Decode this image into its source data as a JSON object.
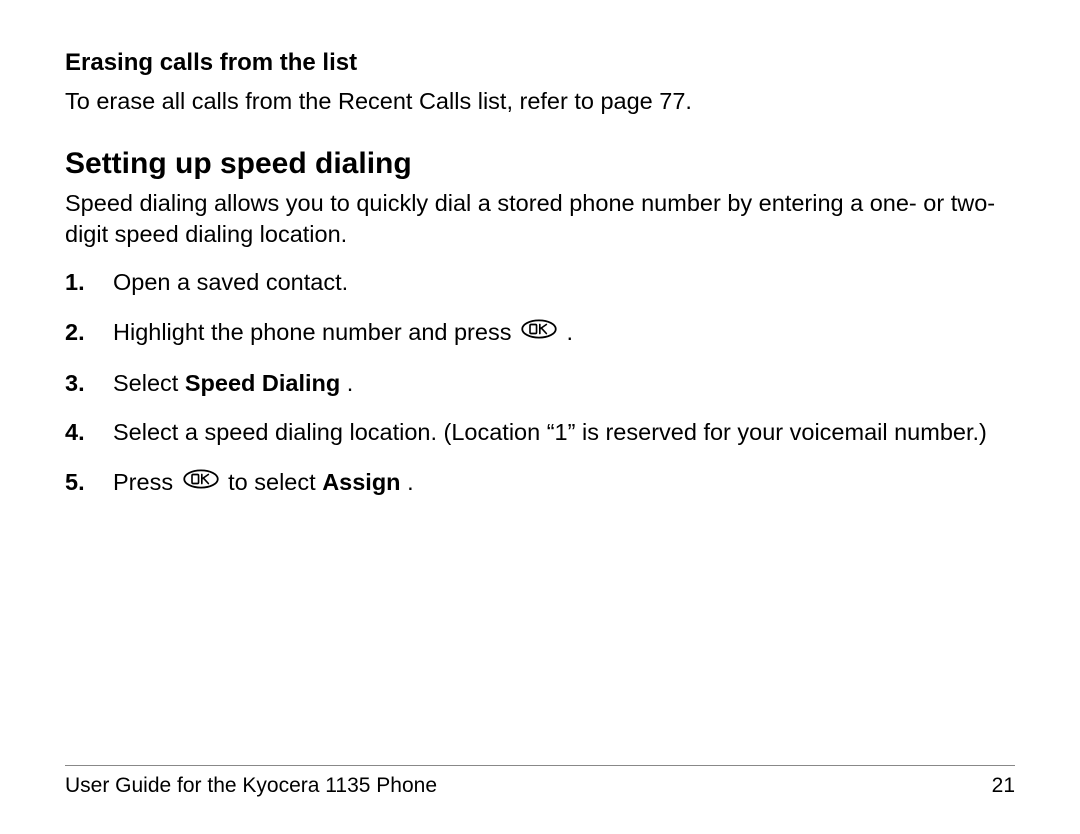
{
  "subsection_heading": "Erasing calls from the list",
  "subsection_body": "To erase all calls from the Recent Calls list, refer to page 77.",
  "section_heading": "Setting up speed dialing",
  "section_intro": "Speed dialing allows you to quickly dial a stored phone number by entering a one- or two-digit speed dialing location.",
  "steps": {
    "s1_num": "1.",
    "s1_text": "Open a saved contact.",
    "s2_num": "2.",
    "s2_text_before": "Highlight the phone number and press ",
    "s2_text_after": " .",
    "s3_num": "3.",
    "s3_text_before": "Select ",
    "s3_bold": "Speed Dialing",
    "s3_text_after": ".",
    "s4_num": "4.",
    "s4_text": "Select a speed dialing location. (Location “1” is reserved for your voicemail number.)",
    "s5_num": "5.",
    "s5_text_before": "Press ",
    "s5_text_mid": " to select ",
    "s5_bold": "Assign",
    "s5_text_after": "."
  },
  "icon_label": "OK",
  "footer_left": "User Guide for the Kyocera 1135 Phone",
  "footer_right": "21"
}
